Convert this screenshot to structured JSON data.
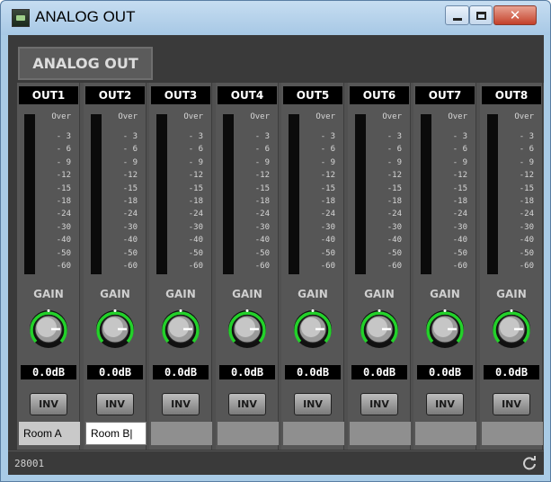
{
  "window": {
    "title": "ANALOG OUT",
    "controls": {
      "minimize": "minimize-icon",
      "maximize": "maximize-icon",
      "close": "✕"
    }
  },
  "panel": {
    "label": "ANALOG OUT"
  },
  "meter_scale": [
    "Over",
    "- 3",
    "- 6",
    "- 9",
    "-12",
    "-15",
    "-18",
    "-24",
    "-30",
    "-40",
    "-50",
    "-60"
  ],
  "channels": [
    {
      "name": "OUT1",
      "gain_label": "GAIN",
      "gain_value": "0.0dB",
      "inv_label": "INV",
      "room": "Room A"
    },
    {
      "name": "OUT2",
      "gain_label": "GAIN",
      "gain_value": "0.0dB",
      "inv_label": "INV",
      "room": "Room B|"
    },
    {
      "name": "OUT3",
      "gain_label": "GAIN",
      "gain_value": "0.0dB",
      "inv_label": "INV",
      "room": ""
    },
    {
      "name": "OUT4",
      "gain_label": "GAIN",
      "gain_value": "0.0dB",
      "inv_label": "INV",
      "room": ""
    },
    {
      "name": "OUT5",
      "gain_label": "GAIN",
      "gain_value": "0.0dB",
      "inv_label": "INV",
      "room": ""
    },
    {
      "name": "OUT6",
      "gain_label": "GAIN",
      "gain_value": "0.0dB",
      "inv_label": "INV",
      "room": ""
    },
    {
      "name": "OUT7",
      "gain_label": "GAIN",
      "gain_value": "0.0dB",
      "inv_label": "INV",
      "room": ""
    },
    {
      "name": "OUT8",
      "gain_label": "GAIN",
      "gain_value": "0.0dB",
      "inv_label": "INV",
      "room": ""
    }
  ],
  "status": {
    "text": "28001",
    "refresh_icon": "refresh-icon"
  },
  "colors": {
    "knob_ring": "#23d12a",
    "panel_bg": "#3a3a3a",
    "strip_bg": "#565656",
    "titlebar": "#a9cbe6"
  }
}
